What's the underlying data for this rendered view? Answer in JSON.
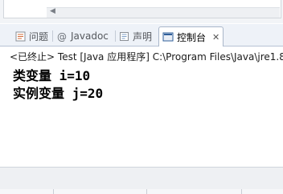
{
  "tabs": [
    {
      "label": "问题",
      "icon": "problems-icon"
    },
    {
      "label": "Javadoc",
      "icon": "javadoc-icon"
    },
    {
      "label": "声明",
      "icon": "declaration-icon"
    },
    {
      "label": "控制台",
      "icon": "console-icon",
      "active": true,
      "close": "✕"
    }
  ],
  "console": {
    "status": "<已终止> Test [Java 应用程序] C:\\Program Files\\Java\\jre1.8",
    "lines": [
      "类变量 i=10",
      "实例变量 j=20"
    ]
  },
  "scroll_arrow": "◀"
}
